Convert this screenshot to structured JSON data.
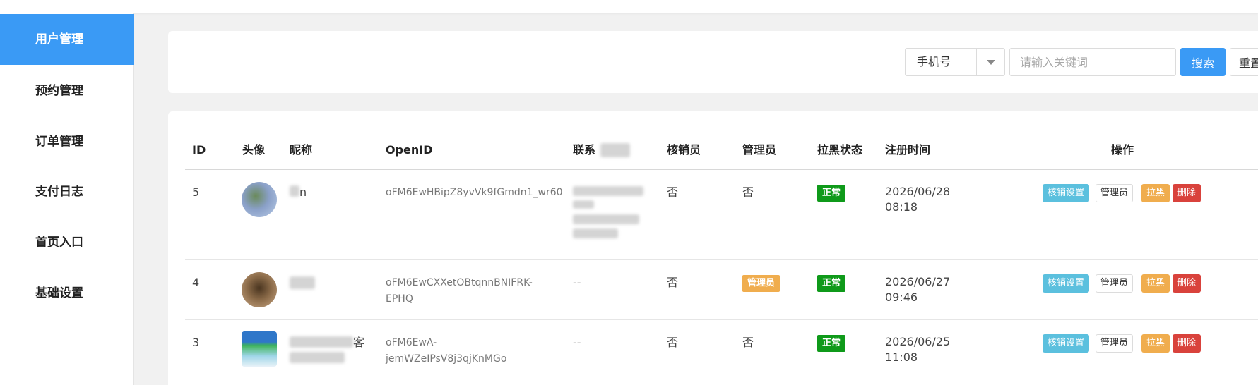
{
  "sidebar": {
    "items": [
      {
        "label": "用户管理",
        "active": true
      },
      {
        "label": "预约管理"
      },
      {
        "label": "订单管理"
      },
      {
        "label": "支付日志"
      },
      {
        "label": "首页入口"
      },
      {
        "label": "基础设置"
      }
    ]
  },
  "search": {
    "field_selected": "手机号",
    "placeholder": "请输入关键词",
    "search_label": "搜索",
    "reset_label": "重置"
  },
  "table": {
    "headers": {
      "id": "ID",
      "avatar": "头像",
      "nickname": "昵称",
      "openid": "OpenID",
      "contact": "联系",
      "verifier": "核销员",
      "admin": "管理员",
      "blacklist": "拉黑状态",
      "registered": "注册时间",
      "actions": "操作"
    },
    "rows": [
      {
        "id": "5",
        "nickname_visible": "n",
        "openid_line1": "oFM6EwHBipZ8yvVk9fGmdn1_wr60",
        "openid_line2": "",
        "contact": "",
        "verifier": "否",
        "admin": "否",
        "status": "正常",
        "date": "2026/06/28",
        "time": "08:18"
      },
      {
        "id": "4",
        "nickname_visible": "",
        "openid_line1": "oFM6EwCXXetOBtqnnBNIFRK-",
        "openid_line2": "EPHQ",
        "contact": "--",
        "verifier": "否",
        "admin": "管理员",
        "status": "正常",
        "date": "2026/06/27",
        "time": "09:46"
      },
      {
        "id": "3",
        "nickname_visible": "客",
        "openid_line1": "oFM6EwA-",
        "openid_line2": "jemWZeIPsV8j3qjKnMGo",
        "contact": "--",
        "verifier": "否",
        "admin": "否",
        "status": "正常",
        "date": "2026/06/25",
        "time": "11:08"
      }
    ],
    "actions": {
      "verify_settings": "核销设置",
      "admin": "管理员",
      "blacklist": "拉黑",
      "delete": "删除"
    }
  },
  "colors": {
    "primary": "#3a9af5",
    "status_green": "#0f9a1a",
    "admin_orange": "#f0ad4e",
    "verify_blue": "#5bc0de",
    "delete_red": "#d9423c"
  }
}
